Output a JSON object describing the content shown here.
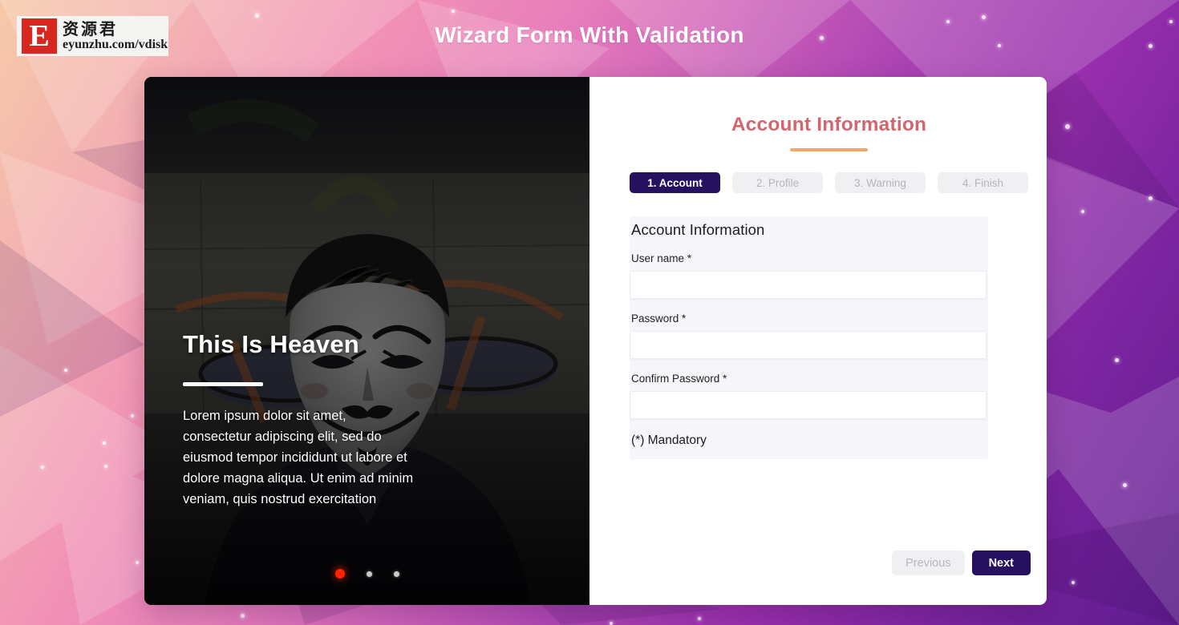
{
  "watermark": {
    "mark_letter": "E",
    "cn_text": "资源君",
    "url_text": "eyunzhu.com/vdisk"
  },
  "header": {
    "title": "Wizard Form With Validation"
  },
  "slide": {
    "heading": "This Is Heaven",
    "body": "Lorem ipsum dolor sit amet, consectetur adipiscing elit, sed do eiusmod tempor incididunt ut labore et dolore magna aliqua. Ut enim ad minim veniam, quis nostrud exercitation",
    "dots": [
      {
        "label": "slide-1",
        "active": true
      },
      {
        "label": "slide-2",
        "active": false
      },
      {
        "label": "slide-3",
        "active": false
      }
    ],
    "photo_alt": "guy-fawkes-mask-photo"
  },
  "wizard": {
    "title": "Account Information",
    "tabs": [
      {
        "label": "1. Account",
        "active": true
      },
      {
        "label": "2. Profile",
        "active": false
      },
      {
        "label": "3. Warning",
        "active": false
      },
      {
        "label": "4. Finish",
        "active": false
      }
    ],
    "section_title": "Account Information",
    "fields": [
      {
        "label": "User name *",
        "value": "",
        "placeholder": "",
        "type": "text"
      },
      {
        "label": "Password *",
        "value": "",
        "placeholder": "",
        "type": "password"
      },
      {
        "label": "Confirm Password *",
        "value": "",
        "placeholder": "",
        "type": "password"
      }
    ],
    "mandatory_note": "(*) Mandatory",
    "buttons": {
      "previous": "Previous",
      "next": "Next"
    }
  },
  "colors": {
    "accent_heading": "#d4646e",
    "accent_rule": "#f0a868",
    "active_tab": "#261060",
    "inactive_tab": "#f0f0f3",
    "active_dot": "#ff2200",
    "logo_red": "#d9271f"
  }
}
